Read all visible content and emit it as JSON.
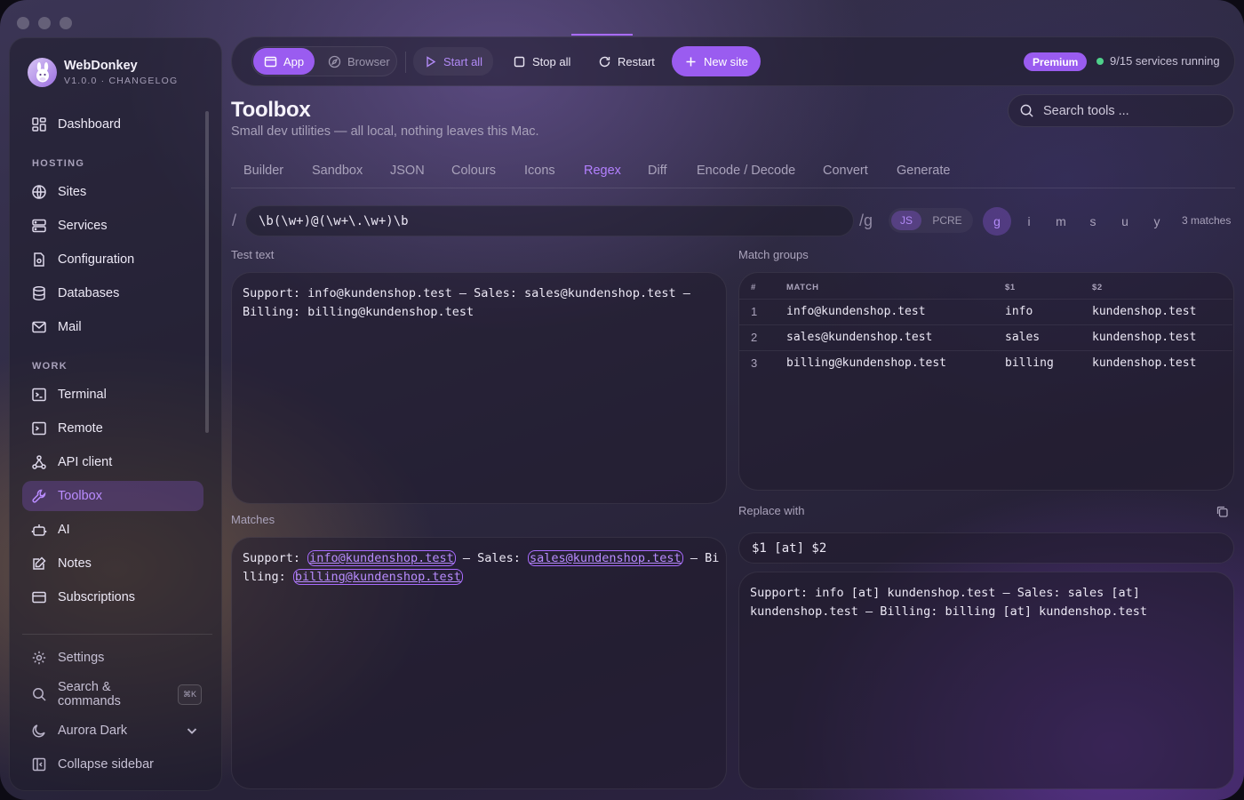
{
  "app": {
    "name": "WebDonkey",
    "version": "V1.0.0 · CHANGELOG"
  },
  "sidebar": {
    "top": [
      {
        "label": "Dashboard",
        "icon": "dashboard-icon"
      }
    ],
    "hosting_title": "HOSTING",
    "hosting": [
      {
        "label": "Sites",
        "icon": "globe-icon"
      },
      {
        "label": "Services",
        "icon": "server-icon"
      },
      {
        "label": "Configuration",
        "icon": "config-file-icon"
      },
      {
        "label": "Databases",
        "icon": "database-icon"
      },
      {
        "label": "Mail",
        "icon": "mail-icon"
      }
    ],
    "work_title": "WORK",
    "work": [
      {
        "label": "Terminal",
        "icon": "terminal-icon"
      },
      {
        "label": "Remote",
        "icon": "remote-terminal-icon"
      },
      {
        "label": "API client",
        "icon": "api-icon"
      },
      {
        "label": "Toolbox",
        "icon": "wrench-icon",
        "active": true
      },
      {
        "label": "AI",
        "icon": "robot-icon"
      },
      {
        "label": "Notes",
        "icon": "notes-icon"
      },
      {
        "label": "Subscriptions",
        "icon": "card-icon"
      }
    ],
    "bottom": {
      "settings": "Settings",
      "search": "Search & commands",
      "search_shortcut": "⌘K",
      "theme": "Aurora Dark",
      "collapse": "Collapse sidebar"
    }
  },
  "toolbar": {
    "app": "App",
    "browser": "Browser",
    "start_all": "Start all",
    "stop_all": "Stop all",
    "restart": "Restart",
    "new_site": "New site",
    "premium": "Premium",
    "services_status": "9/15 services running"
  },
  "page": {
    "title": "Toolbox",
    "subtitle": "Small dev utilities — all local, nothing leaves this Mac.",
    "search_placeholder": "Search tools ..."
  },
  "tabs": [
    "Builder",
    "Sandbox",
    "JSON",
    "Colours",
    "Icons",
    "Regex",
    "Diff",
    "Encode / Decode",
    "Convert",
    "Generate"
  ],
  "active_tab": "Regex",
  "regex": {
    "open_slash": "/",
    "pattern": "\\b(\\w+)@(\\w+\\.\\w+)\\b",
    "close": "/g",
    "engines": [
      "JS",
      "PCRE"
    ],
    "active_engine": "JS",
    "flags": [
      "g",
      "i",
      "m",
      "s",
      "u",
      "y"
    ],
    "active_flags": [
      "g"
    ],
    "match_count": "3 matches"
  },
  "test_text": {
    "label": "Test text",
    "value": "Support: info@kundenshop.test — Sales: sales@kundenshop.test —\nBilling: billing@kundenshop.test"
  },
  "matches": {
    "label": "Matches",
    "prefix1": "Support: ",
    "m1": "info@kundenshop.test",
    "mid1": " — Sales: ",
    "m2": "sales@kundenshop.test",
    "mid2": " — Bi\nlling: ",
    "m3": "billing@kundenshop.test"
  },
  "groups": {
    "label": "Match groups",
    "headers": [
      "#",
      "MATCH",
      "$1",
      "$2"
    ],
    "rows": [
      [
        "1",
        "info@kundenshop.test",
        "info",
        "kundenshop.test"
      ],
      [
        "2",
        "sales@kundenshop.test",
        "sales",
        "kundenshop.test"
      ],
      [
        "3",
        "billing@kundenshop.test",
        "billing",
        "kundenshop.test"
      ]
    ]
  },
  "replace": {
    "label": "Replace with",
    "value": "$1 [at] $2",
    "result": "Support: info [at] kundenshop.test — Sales: sales [at]\nkundenshop.test — Billing: billing [at] kundenshop.test"
  }
}
